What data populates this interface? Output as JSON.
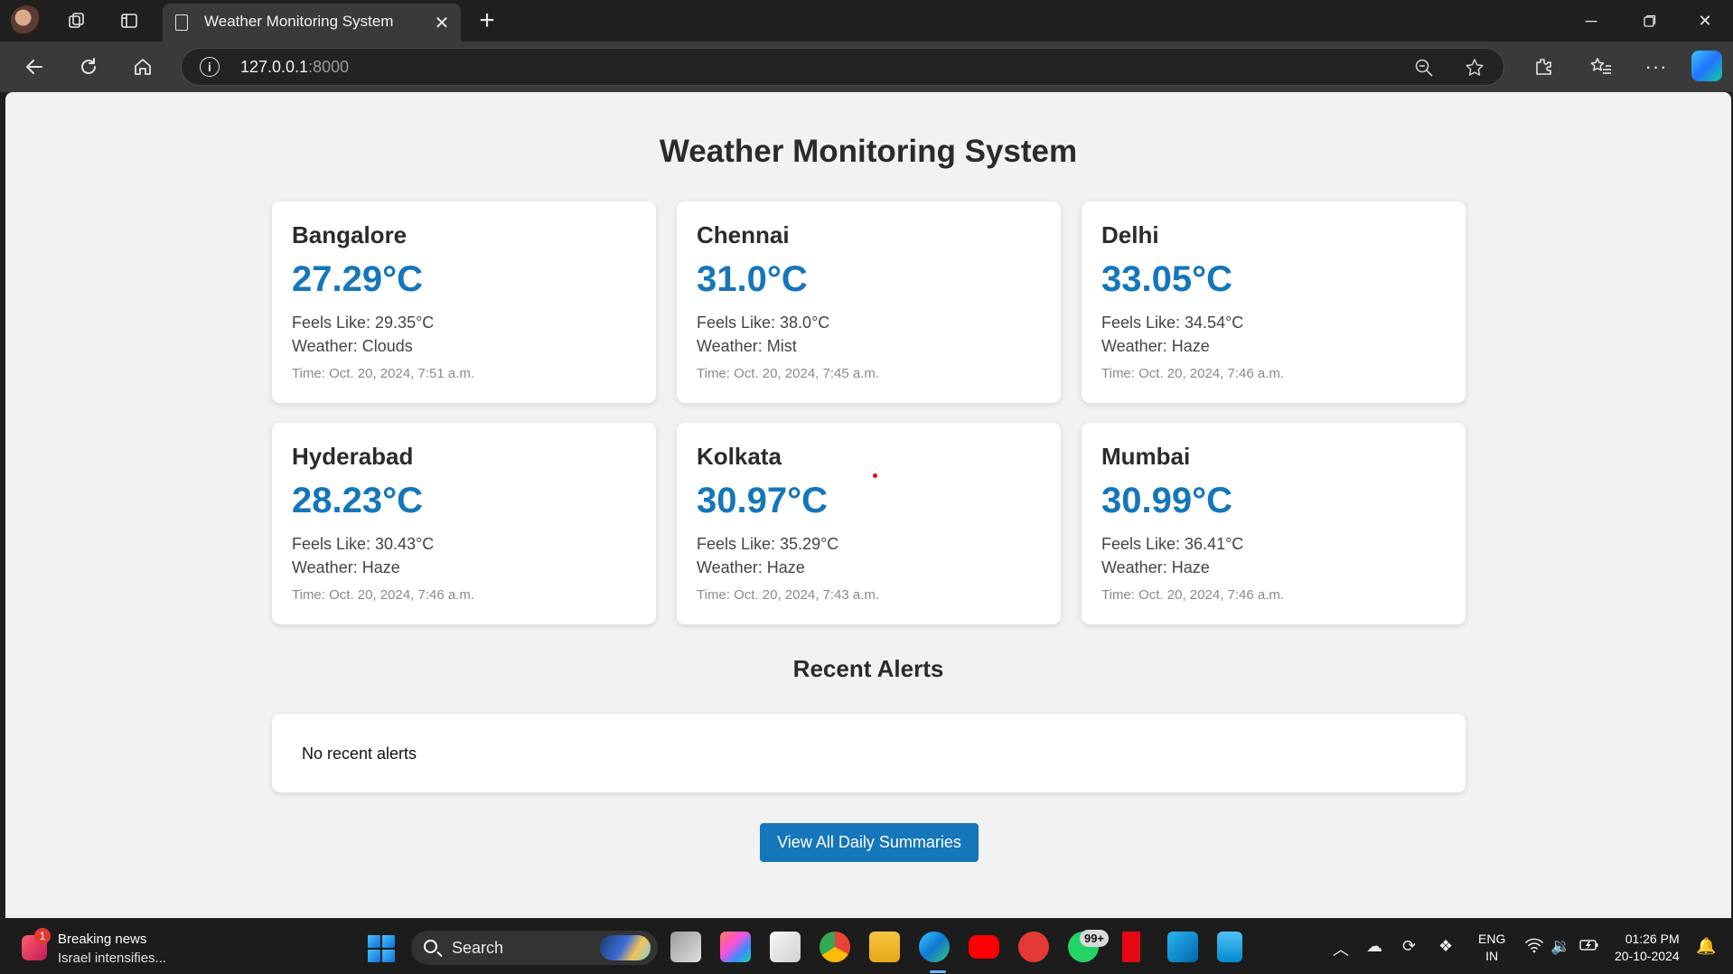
{
  "browser": {
    "tab_title": "Weather Monitoring System",
    "url_host": "127.0.0.1",
    "url_port": ":8000"
  },
  "page": {
    "title": "Weather Monitoring System",
    "cards": [
      {
        "city": "Bangalore",
        "temp": "27.29°C",
        "feels": "Feels Like: 29.35°C",
        "weather": "Weather: Clouds",
        "time": "Time: Oct. 20, 2024, 7:51 a.m."
      },
      {
        "city": "Chennai",
        "temp": "31.0°C",
        "feels": "Feels Like: 38.0°C",
        "weather": "Weather: Mist",
        "time": "Time: Oct. 20, 2024, 7:45 a.m."
      },
      {
        "city": "Delhi",
        "temp": "33.05°C",
        "feels": "Feels Like: 34.54°C",
        "weather": "Weather: Haze",
        "time": "Time: Oct. 20, 2024, 7:46 a.m."
      },
      {
        "city": "Hyderabad",
        "temp": "28.23°C",
        "feels": "Feels Like: 30.43°C",
        "weather": "Weather: Haze",
        "time": "Time: Oct. 20, 2024, 7:46 a.m."
      },
      {
        "city": "Kolkata",
        "temp": "30.97°C",
        "feels": "Feels Like: 35.29°C",
        "weather": "Weather: Haze",
        "time": "Time: Oct. 20, 2024, 7:43 a.m."
      },
      {
        "city": "Mumbai",
        "temp": "30.99°C",
        "feels": "Feels Like: 36.41°C",
        "weather": "Weather: Haze",
        "time": "Time: Oct. 20, 2024, 7:46 a.m."
      }
    ],
    "alerts_title": "Recent Alerts",
    "alerts_text": "No recent alerts",
    "summary_button": "View All Daily Summaries",
    "accent_color": "#1576ba"
  },
  "taskbar": {
    "news_badge": "1",
    "news_title": "Breaking news",
    "news_sub": "Israel intensifies...",
    "search_label": "Search",
    "whatsapp_badge": "99+",
    "lang_top": "ENG",
    "lang_bottom": "IN",
    "time": "01:26 PM",
    "date": "20-10-2024"
  }
}
